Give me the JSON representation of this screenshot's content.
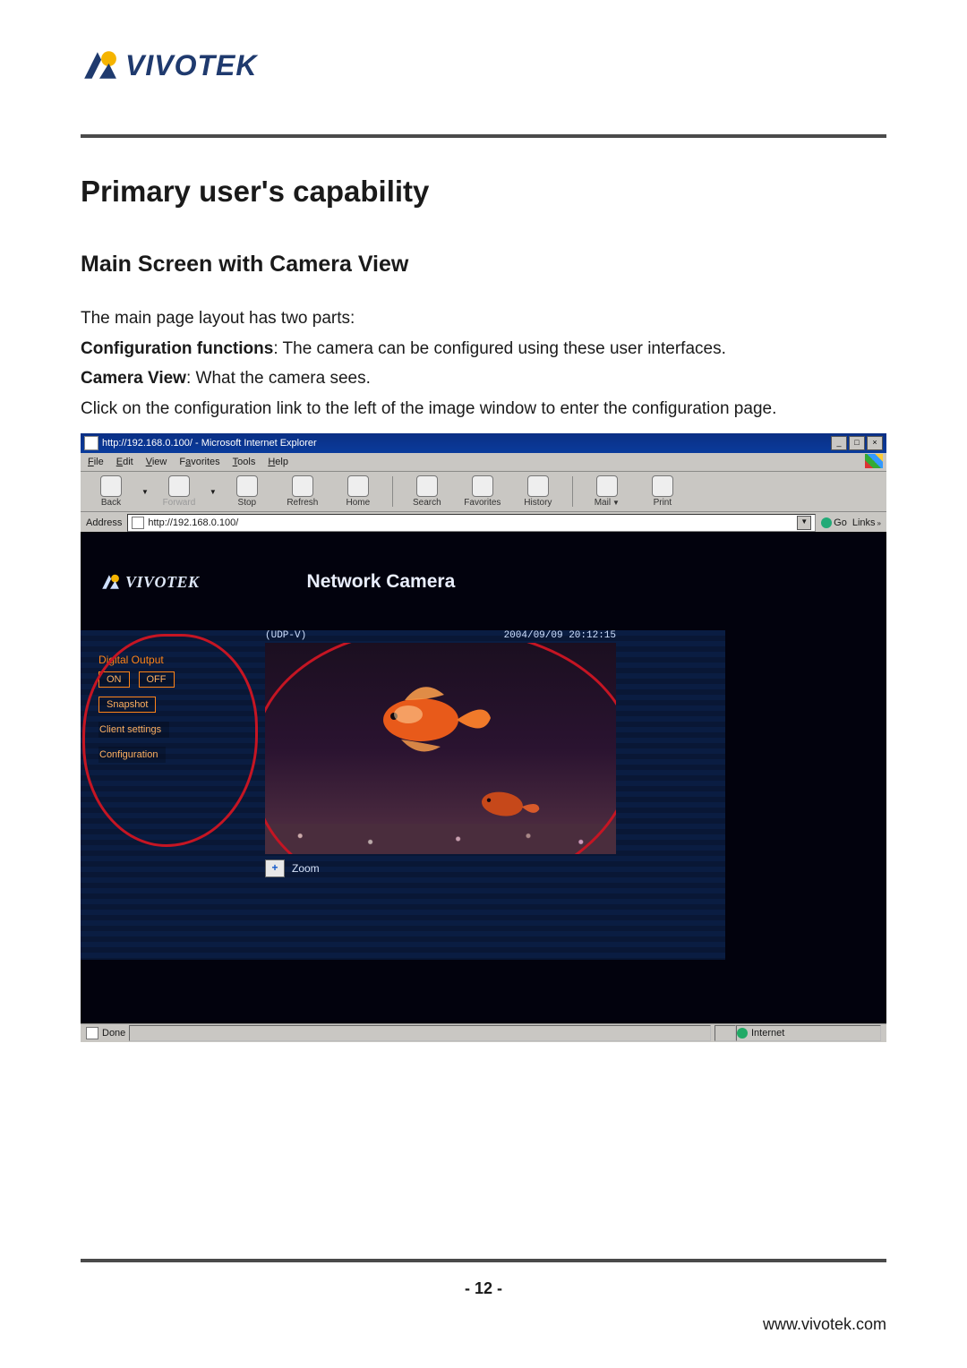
{
  "logo_brand": "VIVOTEK",
  "headings": {
    "h1": "Primary user's capability",
    "h2": "Main Screen with Camera View"
  },
  "paragraphs": {
    "intro": "The main page layout has two parts:",
    "cfg_label": "Configuration functions",
    "cfg_text": ": The camera can be configured using these user interfaces.",
    "cam_label": "Camera View",
    "cam_text": ": What the camera sees.",
    "click_text": "Click on the configuration link to the left of the image window to enter the configuration page."
  },
  "ie": {
    "title": "http://192.168.0.100/ - Microsoft Internet Explorer",
    "menu": [
      "File",
      "Edit",
      "View",
      "Favorites",
      "Tools",
      "Help"
    ],
    "toolbar": {
      "back": "Back",
      "forward": "Forward",
      "stop": "Stop",
      "refresh": "Refresh",
      "home": "Home",
      "search": "Search",
      "favorites": "Favorites",
      "history": "History",
      "mail": "Mail",
      "print": "Print"
    },
    "address_label": "Address",
    "address_value": "http://192.168.0.100/",
    "go": "Go",
    "links": "Links",
    "status_done": "Done",
    "status_zone": "Internet"
  },
  "camera_page": {
    "brand": "VIVOTEK",
    "title": "Network Camera",
    "protocol": "(UDP-V)",
    "timestamp": "2004/09/09 20:12:15",
    "side": {
      "digital_output": "Digital Output",
      "on": "ON",
      "off": "OFF",
      "snapshot": "Snapshot",
      "client_settings": "Client settings",
      "configuration": "Configuration"
    },
    "zoom": {
      "plus": "+",
      "label": "Zoom"
    }
  },
  "footer": {
    "page_number": "- 12 -",
    "url": "www.vivotek.com"
  }
}
